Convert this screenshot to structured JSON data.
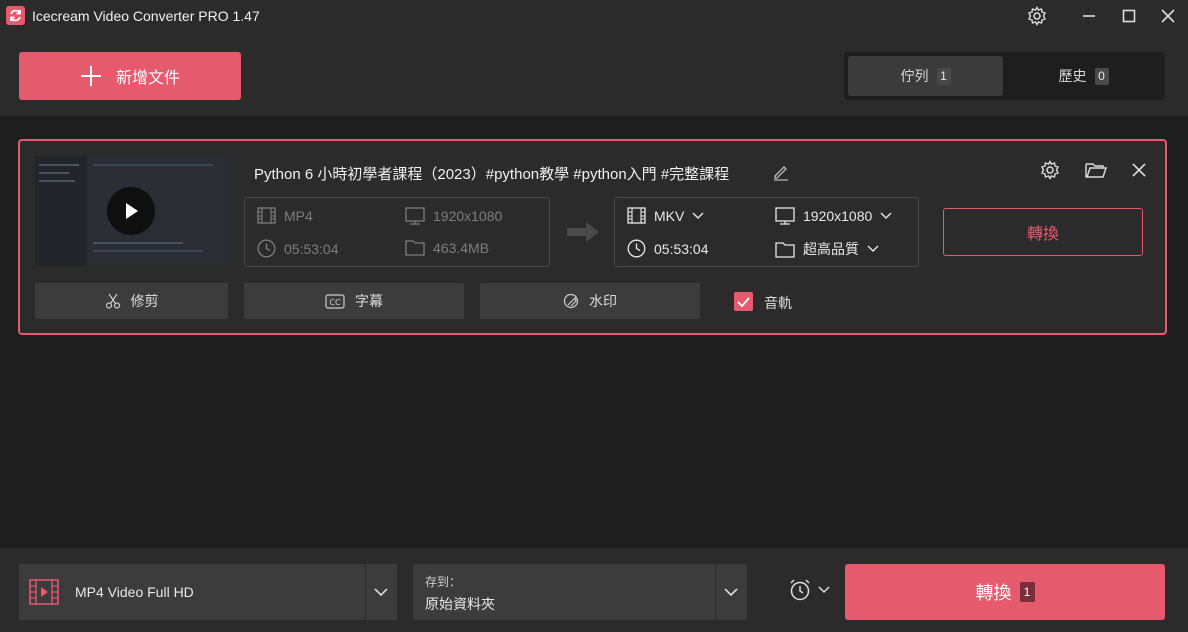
{
  "app": {
    "title": "Icecream Video Converter PRO 1.47"
  },
  "toolbar": {
    "add_label": "新增文件"
  },
  "tabs": [
    {
      "label": "佇列",
      "count": "1"
    },
    {
      "label": "歷史",
      "count": "0"
    }
  ],
  "item": {
    "title": "Python 6 小時初學者課程（2023）#python教學 #python入門 #完整課程",
    "source": {
      "format": "MP4",
      "resolution": "1920x1080",
      "duration": "05:53:04",
      "size": "463.4MB"
    },
    "target": {
      "format": "MKV",
      "resolution": "1920x1080",
      "duration": "05:53:04",
      "quality": "超高品質"
    },
    "convert_label": "轉換",
    "actions": {
      "trim": "修剪",
      "subtitles": "字幕",
      "watermark": "水印",
      "audio": "音軌"
    },
    "audio_checked": true
  },
  "bottom": {
    "preset": "MP4 Video Full HD",
    "save_label": "存到：",
    "save_value": "原始資料夾",
    "convert_label": "轉換",
    "convert_count": "1"
  },
  "colors": {
    "accent": "#e65a6e",
    "background": "#1e1e1e",
    "panel": "#2b2b2b"
  }
}
